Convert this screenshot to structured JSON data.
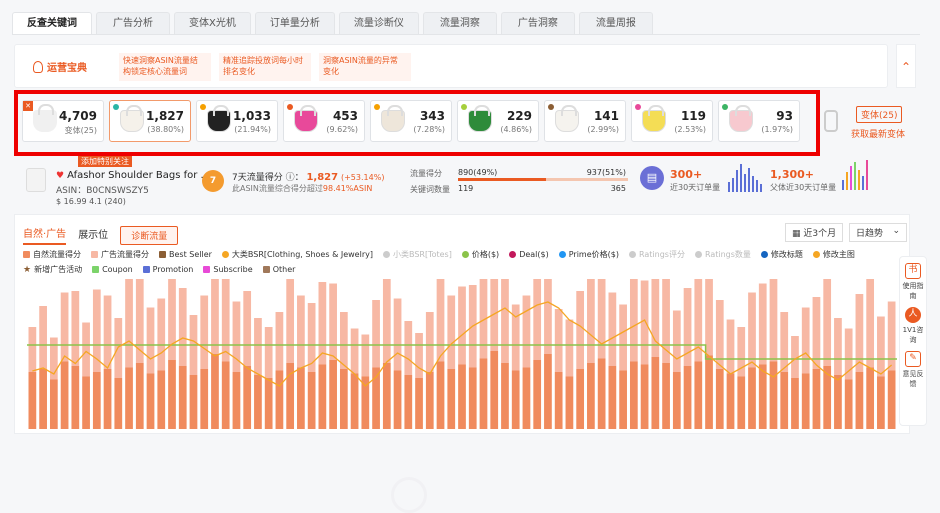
{
  "tabs": [
    "反查关键词",
    "广告分析",
    "变体X光机",
    "订单量分析",
    "流量诊断仪",
    "流量洞察",
    "广告洞察",
    "流量周报"
  ],
  "ops": {
    "title": "运营宝典",
    "tips": [
      "快速洞察ASIN流量结\n构锁定核心流量词",
      "精准追踪投放词每小时\n排名变化",
      "洞察ASIN流量的异常\n变化"
    ],
    "collapse": "⌃"
  },
  "variants": {
    "total": {
      "value": "4,709",
      "label": "变体(25)"
    },
    "items": [
      {
        "value": "1,827",
        "pct": "(38.80%)",
        "dot": "#2bb5a5",
        "bag": "#f5f1ea",
        "selected": true
      },
      {
        "value": "1,033",
        "pct": "(21.94%)",
        "dot": "#f5a000",
        "bag": "#222222"
      },
      {
        "value": "453",
        "pct": "(9.62%)",
        "dot": "#ea5a22",
        "bag": "#e8499a"
      },
      {
        "value": "343",
        "pct": "(7.28%)",
        "dot": "#f5a000",
        "bag": "#eee6da"
      },
      {
        "value": "229",
        "pct": "(4.86%)",
        "dot": "#a6cf3c",
        "bag": "#2e8b3a"
      },
      {
        "value": "141",
        "pct": "(2.99%)",
        "dot": "#8b5e34",
        "bag": "#f5f3ee"
      },
      {
        "value": "119",
        "pct": "(2.53%)",
        "dot": "#e8499a",
        "bag": "#f4dd55"
      },
      {
        "value": "93",
        "pct": "(1.97%)",
        "dot": "#3cb464",
        "bag": "#f7c9cf"
      }
    ],
    "badge": "变体(25)",
    "link": "获取最新变体"
  },
  "product": {
    "follow": "添加特别关注",
    "title": "Afashor Shoulder Bags for ...",
    "asin": "ASIN：B0CNSWSZY5",
    "price": "$ 16.99 4.1 (240)"
  },
  "score": {
    "icon": "7",
    "label": "7天流量得分",
    "value": "1,827",
    "change": "(+53.14%)",
    "desc": "此ASIN流量综合得分超过",
    "desc_pct": "98.41%ASIN"
  },
  "traffic": {
    "score_label": "流量得分",
    "score_val": "890(49%)",
    "score_right": "937(51%)",
    "kw_label": "关键词数量",
    "kw_val": "119",
    "kw_right": "365"
  },
  "kpi": {
    "orders": "300+",
    "orders_label": "近30天订单量",
    "parent": "1,300+",
    "parent_label": "父体近30天订单量"
  },
  "chart_controls": {
    "tab1": "自然·广告",
    "tab2": "展示位",
    "diag": "诊断流量",
    "range": "近3个月",
    "trend": "日趋势"
  },
  "legend": [
    {
      "label": "自然流量得分",
      "color": "#f08b5e",
      "shape": "sw"
    },
    {
      "label": "广告流量得分",
      "color": "#f7b8a4",
      "shape": "sw"
    },
    {
      "label": "Best Seller",
      "color": "#8b5e34",
      "shape": "sw"
    },
    {
      "label": "大类BSR[Clothing, Shoes & Jewelry]",
      "color": "#f5a623",
      "shape": "dot"
    },
    {
      "label": "小类BSR[Totes]",
      "color": "#cccccc",
      "shape": "dot",
      "dim": true
    },
    {
      "label": "价格($)",
      "color": "#8bc34a",
      "shape": "dot"
    },
    {
      "label": "Deal($)",
      "color": "#c2185b",
      "shape": "dot"
    },
    {
      "label": "Prime价格($)",
      "color": "#2196f3",
      "shape": "dot"
    },
    {
      "label": "Ratings评分",
      "color": "#cccccc",
      "shape": "dot",
      "dim": true
    },
    {
      "label": "Ratings数量",
      "color": "#cccccc",
      "shape": "dot",
      "dim": true
    },
    {
      "label": "修改标题",
      "color": "#1565c0",
      "shape": "dot"
    },
    {
      "label": "修改主图",
      "color": "#f5a623",
      "shape": "dot"
    },
    {
      "label": "新增广告活动",
      "color": "#8b5e34",
      "shape": "star"
    },
    {
      "label": "Coupon",
      "color": "#7cd36a",
      "shape": "sw"
    },
    {
      "label": "Promotion",
      "color": "#5b6fd6",
      "shape": "sw"
    },
    {
      "label": "Subscribe",
      "color": "#e84ad7",
      "shape": "sw"
    },
    {
      "label": "Other",
      "color": "#a0785a",
      "shape": "sw"
    }
  ],
  "side": [
    {
      "label": "使用指南",
      "icon": "书"
    },
    {
      "label": "1V1咨询",
      "icon": "人"
    },
    {
      "label": "意见反馈",
      "icon": "✎"
    }
  ],
  "chart_data": {
    "type": "bar",
    "series": [
      {
        "name": "自然流量得分",
        "values": [
          38,
          40,
          33,
          45,
          42,
          35,
          38,
          40,
          34,
          41,
          44,
          37,
          39,
          46,
          42,
          36,
          40,
          50,
          45,
          38,
          42,
          36,
          34,
          39,
          44,
          41,
          38,
          43,
          46,
          40,
          37,
          35,
          41,
          44,
          39,
          36,
          34,
          38,
          45,
          40,
          43,
          41,
          47,
          52,
          44,
          39,
          41,
          46,
          50,
          38,
          35,
          40,
          44,
          47,
          42,
          39,
          45,
          43,
          48,
          44,
          38,
          42,
          45,
          49,
          40,
          37,
          35,
          41,
          43,
          45,
          38,
          34,
          37,
          40,
          42,
          36,
          33,
          38,
          41,
          35,
          39
        ]
      },
      {
        "name": "广告流量得分",
        "values": [
          30,
          42,
          28,
          46,
          50,
          36,
          55,
          49,
          40,
          62,
          58,
          44,
          48,
          65,
          52,
          40,
          49,
          54,
          60,
          47,
          50,
          38,
          34,
          39,
          62,
          48,
          46,
          55,
          51,
          38,
          30,
          28,
          45,
          64,
          48,
          36,
          30,
          40,
          60,
          49,
          52,
          55,
          70,
          88,
          68,
          44,
          48,
          75,
          74,
          42,
          38,
          52,
          58,
          72,
          49,
          44,
          60,
          56,
          66,
          62,
          41,
          52,
          58,
          64,
          46,
          36,
          33,
          50,
          54,
          58,
          40,
          28,
          44,
          48,
          60,
          38,
          34,
          52,
          62,
          40,
          46
        ]
      },
      {
        "name": "大类BSR[Clothing, Shoes & Jewelry]",
        "values": [
          60,
          58,
          62,
          50,
          55,
          47,
          52,
          58,
          44,
          40,
          46,
          52,
          48,
          42,
          38,
          40,
          45,
          50,
          47,
          52,
          58,
          62,
          66,
          70,
          62,
          58,
          55,
          48,
          50,
          56,
          62,
          70,
          64,
          54,
          48,
          52,
          58,
          62,
          50,
          42,
          36,
          30,
          26,
          22,
          18,
          24,
          20,
          16,
          14,
          18,
          26,
          30,
          36,
          42,
          38,
          34,
          30,
          26,
          40,
          46,
          52,
          48,
          44,
          50,
          56,
          62,
          58,
          54,
          60,
          64,
          58,
          52,
          48,
          56,
          62,
          66,
          60,
          54,
          58,
          62,
          56
        ]
      },
      {
        "name": "价格($)",
        "values": [
          1,
          1,
          1,
          1,
          1,
          1,
          1,
          1,
          1,
          1,
          1,
          1,
          1,
          1,
          1,
          1,
          1,
          1,
          1,
          1,
          1,
          1,
          1,
          1,
          1,
          1,
          1,
          1,
          1,
          1,
          1,
          1,
          1,
          1,
          1,
          1,
          1,
          1,
          1,
          1,
          1,
          1,
          1,
          1,
          1,
          1,
          1,
          1,
          1,
          1,
          1,
          1,
          1,
          1,
          1,
          1,
          1,
          1,
          1,
          1,
          1,
          1,
          1,
          1,
          1,
          1,
          1,
          1,
          1,
          1,
          1,
          1,
          1,
          1,
          1,
          1,
          1,
          1,
          1,
          1,
          1
        ]
      }
    ]
  }
}
